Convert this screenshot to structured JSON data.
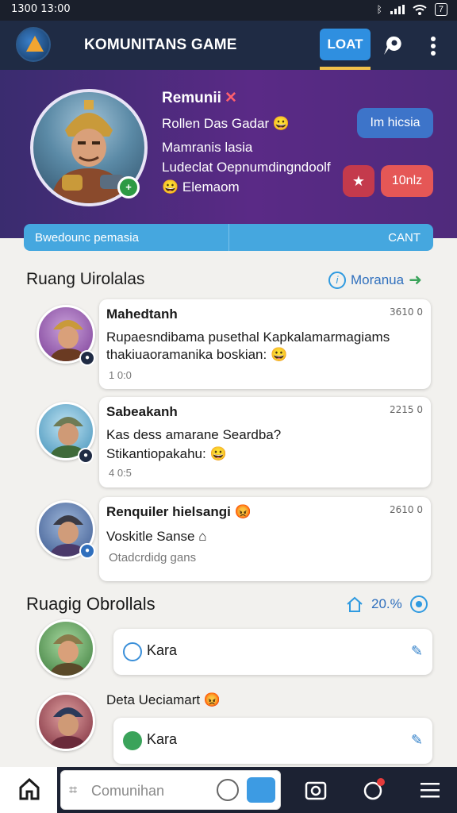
{
  "status_bar": {
    "time": "1300 13:00",
    "battery": "7"
  },
  "app_bar": {
    "title": "KOMUNITANS GAME",
    "loat_button": "LOAT"
  },
  "profile": {
    "name": "Remunii",
    "name_mark": "✕",
    "line1": "Rollen Das Gadar",
    "line2": "Mamranis lasia",
    "line3": "Ludeclat Oepnumdingndoolf",
    "line4": "Elemaom",
    "action_button": "Im hicsia",
    "star_button": "★",
    "count_button": "10nlz"
  },
  "banner": {
    "left": "Bwedounc pemasia",
    "right": "CANT"
  },
  "section1": {
    "title": "Ruang Uirolalas",
    "more_link": "Moranua"
  },
  "messages": [
    {
      "sender": "Mahedtanh",
      "time": "3610 0",
      "text1": "Rupaesndibama pusethal Kapkalamarmagiams",
      "text2": "thakiuaoramanika boskian:",
      "meta": "1 0:0",
      "emoji": "😀"
    },
    {
      "sender": "Sabeakanh",
      "time": "2215 0",
      "text1": "Kas dess amarane Seardba?",
      "text2": "Stikantiopakahu:",
      "meta": "4 0:5",
      "emoji": "😀"
    },
    {
      "sender": "Renquiler hielsangi",
      "time": "2610 0",
      "text1": "Voskitle Sanse",
      "text2": "Otadcrdidg gans",
      "meta": "",
      "emoji": "😡"
    }
  ],
  "section2": {
    "title": "Ruagig Obrollals",
    "percent": "20.%"
  },
  "replies": [
    {
      "label": "Kara",
      "heading": ""
    },
    {
      "label": "Kara",
      "heading": "Deta Ueciamart"
    }
  ],
  "composer": {
    "placeholder": "Comunihan"
  },
  "colors": {
    "appbar": "#1f2b44",
    "hero": "#5a2a86",
    "accent": "#2f8fe0",
    "banner": "#45a7df",
    "danger": "#e55756"
  }
}
